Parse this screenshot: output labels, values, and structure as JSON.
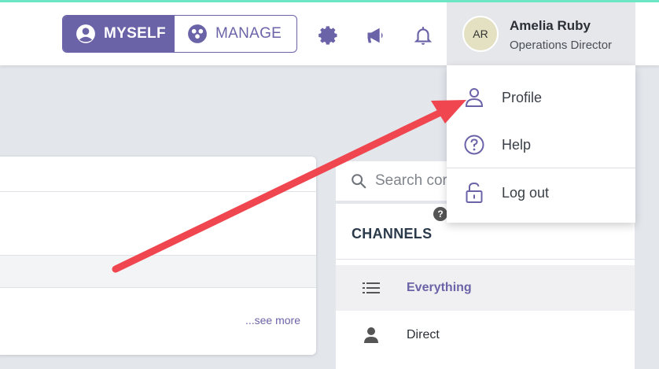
{
  "header": {
    "mode_toggle": {
      "active_label": "MYSELF",
      "inactive_label": "MANAGE"
    },
    "icons": [
      "gear-icon",
      "megaphone-icon",
      "bell-icon"
    ],
    "user": {
      "initials": "AR",
      "name": "Amelia Ruby",
      "role": "Operations Director"
    }
  },
  "user_menu": {
    "items": [
      {
        "icon": "person-icon",
        "label": "Profile"
      },
      {
        "icon": "question-circle-icon",
        "label": "Help"
      },
      {
        "icon": "lock-icon",
        "label": "Log out"
      }
    ]
  },
  "card": {
    "see_more": "...see more"
  },
  "search": {
    "placeholder": "Search cor"
  },
  "channels": {
    "title": "CHANNELS",
    "help_glyph": "?",
    "items": [
      {
        "icon": "list-icon",
        "label": "Everything",
        "selected": true
      },
      {
        "icon": "person-icon",
        "label": "Direct",
        "selected": false
      }
    ]
  },
  "colors": {
    "accent": "#6b63a8",
    "annotation_arrow": "#ef4650",
    "top_strip": "#6ee7c6"
  }
}
